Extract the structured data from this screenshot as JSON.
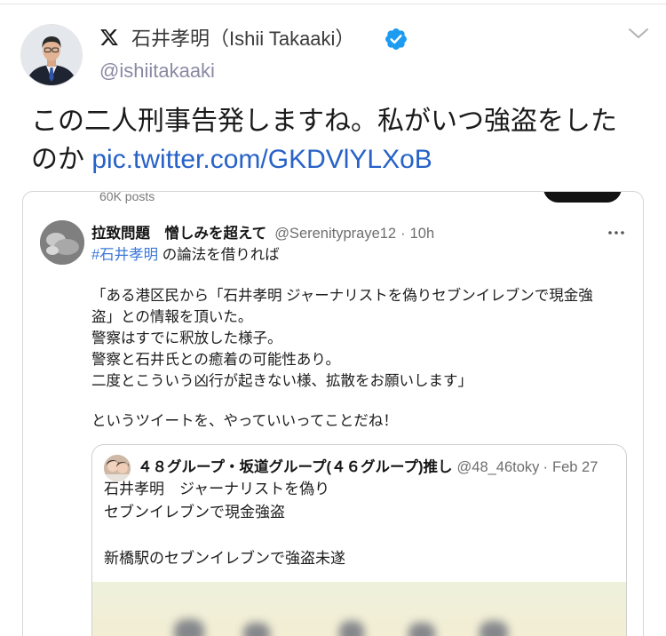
{
  "colors": {
    "text": "#1a1a1a",
    "name": "#3a3a3a",
    "handle": "#8a89a3",
    "link": "#2762c8",
    "verified": "#1d9bf0",
    "hashtag": "#3b78d6",
    "muted": "#6e6e6e",
    "border": "#d6d6d6"
  },
  "tweet": {
    "brand_icon": "x-logo-icon",
    "author": {
      "name": "石井孝明（Ishii Takaaki）",
      "handle": "@ishiitakaaki",
      "verified": true,
      "verified_icon": "verified-badge-icon",
      "avatar": "profile-photo"
    },
    "menu_icon": "chevron-down-icon",
    "text": "この二人刑事告発しますね。私がいつ強盗をしたのか",
    "link": "pic.twitter.com/GKDVlYLXoB"
  },
  "media": {
    "header_label": "60K posts",
    "post": {
      "display_name": "拉致問題　憎しみを超えて",
      "handle": "@Serenitypraye12",
      "separator": "·",
      "time": "10h",
      "more_icon": "more-dots-icon",
      "hashtag": "#石井孝明",
      "intro": " の論法を借りれば",
      "body_lines": [
        "「ある港区民から「石井孝明 ジャーナリストを偽りセブンイレブンで現金強",
        "盗」との情報を頂いた。",
        "警察はすでに釈放した様子。",
        "警察と石井氏との癒着の可能性あり。",
        "二度とこういう凶行が起きない様、拡散をお願いします」"
      ],
      "closing": "というツイートを、やっていいってことだね！"
    },
    "quote": {
      "display_name": "４８グループ・坂道グループ(４６グループ)推し",
      "handle": "@48_46tokyo",
      "separator": "·",
      "date": "Feb 27",
      "lines": [
        "石井孝明　ジャーナリストを偽り",
        "セブンイレブンで現金強盗",
        "新橋駅のセブンイレブンで強盗未遂"
      ]
    }
  }
}
